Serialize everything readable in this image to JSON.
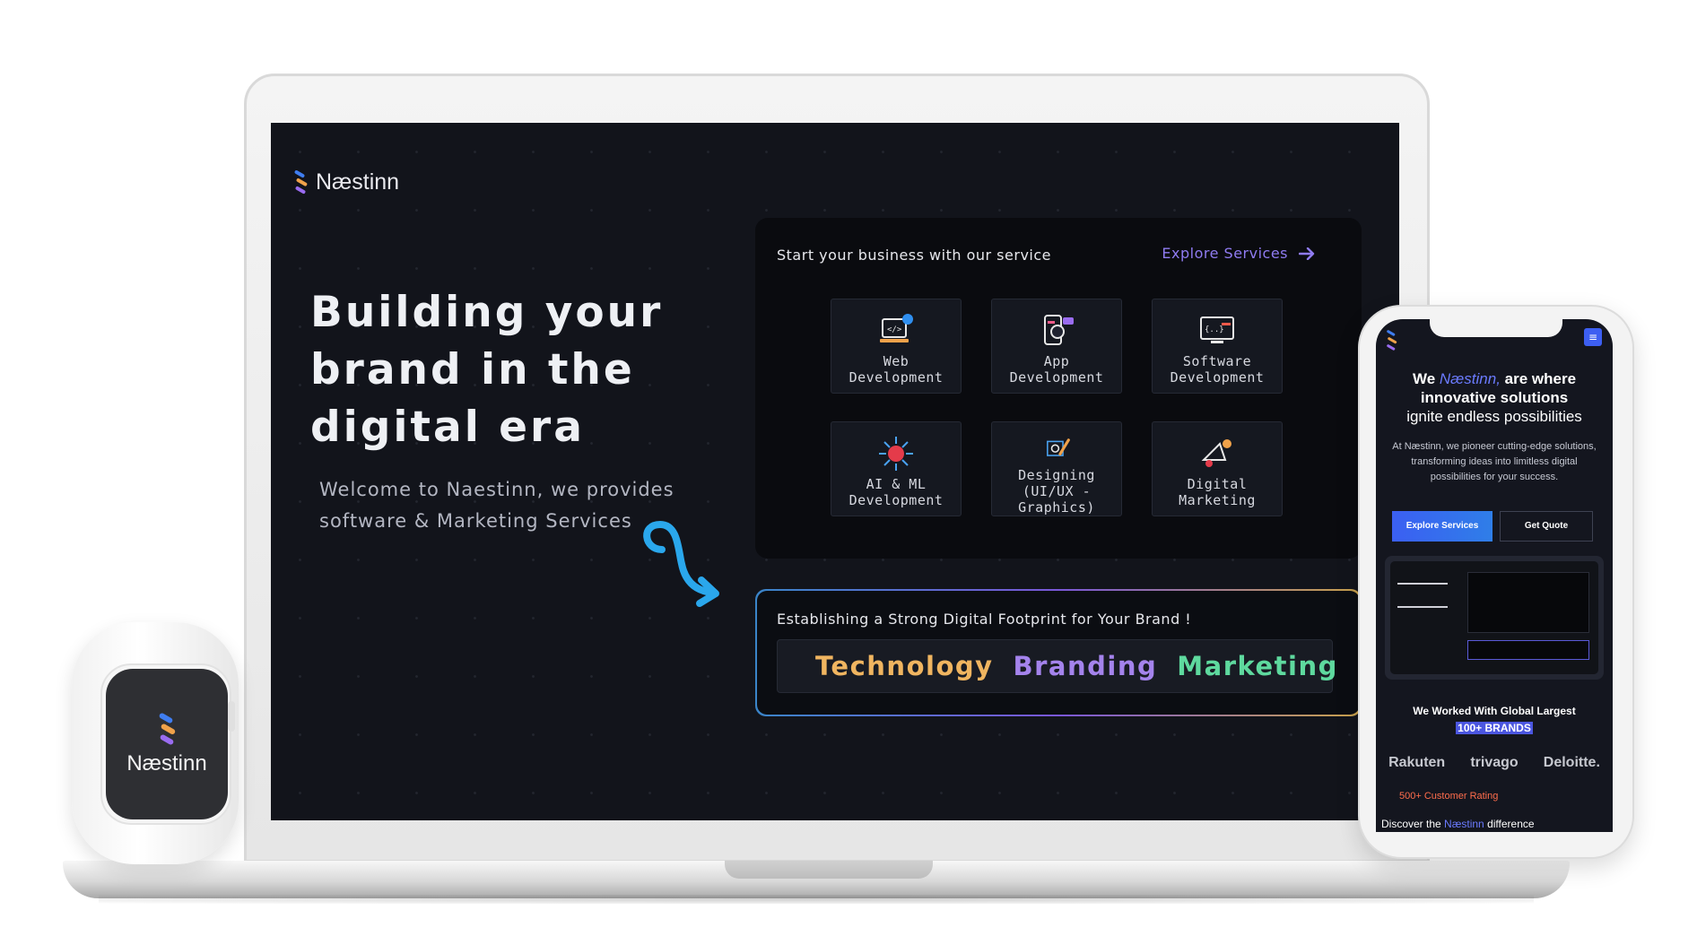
{
  "laptop": {
    "brand": "Næstinn",
    "hero_title": "Building your brand in the digital era",
    "hero_subtitle": "Welcome to Naestinn, we provides software & Marketing Services",
    "services_panel": {
      "title": "Start your business with our service",
      "explore_link": "Explore Services",
      "items": [
        {
          "label": "Web\nDevelopment",
          "icon": "web-development-icon"
        },
        {
          "label": "App\nDevelopment",
          "icon": "app-development-icon"
        },
        {
          "label": "Software\nDevelopment",
          "icon": "software-development-icon"
        },
        {
          "label": "AI & ML\nDevelopment",
          "icon": "ai-ml-icon"
        },
        {
          "label": "Designing\n(UI/UX - Graphics)",
          "icon": "design-icon"
        },
        {
          "label": "Digital\nMarketing",
          "icon": "marketing-icon"
        }
      ]
    },
    "footprint_panel": {
      "title": "Establishing a Strong Digital Footprint for Your Brand !",
      "words": [
        "Technology",
        "Branding",
        "Marketing"
      ]
    }
  },
  "watch": {
    "brand": "Næstinn"
  },
  "phone": {
    "headline_we": "We",
    "headline_brand": "Næstinn,",
    "headline_rest": "are where innovative solutions",
    "headline_tail": "ignite endless possibilities",
    "body": "At Næstinn, we pioneer cutting-edge solutions, transforming ideas into limitless digital possibilities for your success.",
    "cta_primary": "Explore Services",
    "cta_secondary": "Get Quote",
    "brands_title": "We Worked With Global Largest",
    "brands_count": "100+ BRANDS",
    "brands": [
      "Rakuten",
      "trivago",
      "Deloitte."
    ],
    "rating": "500+ Customer Rating",
    "discover_pre": "Discover the",
    "discover_brand": "Næstinn",
    "discover_post": "difference"
  },
  "colors": {
    "accent_purple": "#8f7bf0",
    "accent_blue": "#3b5ff2",
    "screen_bg": "#12141b"
  }
}
